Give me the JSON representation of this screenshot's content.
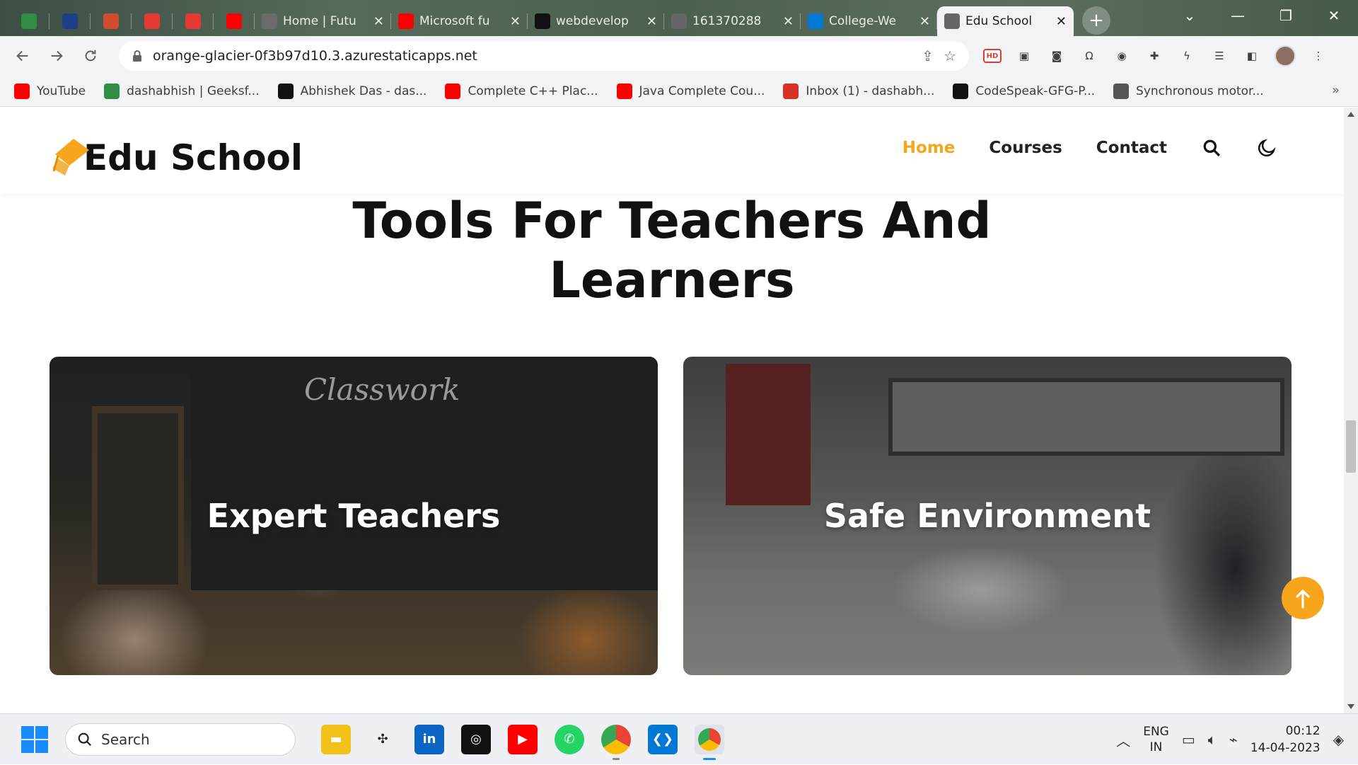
{
  "browser": {
    "tabs": [
      {
        "title": "",
        "icon": "geeksforgeeks-icon",
        "color": "#2f8d46",
        "pinned": true
      },
      {
        "title": "",
        "icon": "elcdn-icon",
        "color": "#1d3f8a",
        "pinned": true
      },
      {
        "title": "",
        "icon": "bharat-intern-icon",
        "color": "#d14b2e",
        "pinned": true
      },
      {
        "title": "",
        "icon": "apple-red-icon",
        "color": "#e53935",
        "pinned": true
      },
      {
        "title": "",
        "icon": "apple-red-icon",
        "color": "#e53935",
        "pinned": true
      },
      {
        "title": "",
        "icon": "youtube-icon",
        "color": "#ff0000",
        "pinned": true
      },
      {
        "title": "Home | Futu",
        "icon": "site-icon",
        "color": "#6b6b6b",
        "pinned": false
      },
      {
        "title": "Microsoft fu",
        "icon": "youtube-icon",
        "color": "#ff0000",
        "pinned": false
      },
      {
        "title": "webdevelop",
        "icon": "github-icon",
        "color": "#111111",
        "pinned": false
      },
      {
        "title": "161370288",
        "icon": "globe-icon",
        "color": "#666666",
        "pinned": false
      },
      {
        "title": "College-We",
        "icon": "azure-icon",
        "color": "#0078d4",
        "pinned": false
      },
      {
        "title": "Edu School",
        "icon": "globe-icon",
        "color": "#666666",
        "pinned": false,
        "active": true
      }
    ],
    "new_tab": "+",
    "url": "orange-glacier-0f3b97d10.3.azurestaticapps.net",
    "bookmarks": [
      {
        "label": "YouTube",
        "icon": "youtube-icon",
        "color": "#ff0000"
      },
      {
        "label": "dashabhish | Geeksf...",
        "icon": "geeksforgeeks-icon",
        "color": "#2f8d46"
      },
      {
        "label": "Abhishek Das - das...",
        "icon": "hashnode-icon",
        "color": "#111111"
      },
      {
        "label": "Complete C++ Plac...",
        "icon": "youtube-icon",
        "color": "#ff0000"
      },
      {
        "label": "Java Complete Cou...",
        "icon": "youtube-icon",
        "color": "#ff0000"
      },
      {
        "label": "Inbox (1) - dashabh...",
        "icon": "gmail-icon",
        "color": "#d93025"
      },
      {
        "label": "CodeSpeak-GFG-P...",
        "icon": "github-icon",
        "color": "#111111"
      },
      {
        "label": "Synchronous motor...",
        "icon": "globe-icon",
        "color": "#555555"
      }
    ],
    "bookmarks_more": "»"
  },
  "site": {
    "logo_text": "Edu School",
    "nav": [
      {
        "label": "Home",
        "active": true
      },
      {
        "label": "Courses",
        "active": false
      },
      {
        "label": "Contact",
        "active": false
      }
    ],
    "accent_color": "#f7a51c",
    "section_title_line1": "Tools For Teachers And",
    "section_title_line2": "Learners",
    "cards": [
      {
        "label": "Expert Teachers",
        "chalk": "Classwork"
      },
      {
        "label": "Safe Environment"
      }
    ]
  },
  "taskbar": {
    "search_placeholder": "Search",
    "apps": [
      "file-explorer-icon",
      "chatgpt-icon",
      "linkedin-icon",
      "github-icon",
      "youtube-icon",
      "whatsapp-icon",
      "chrome-icon",
      "vscode-icon",
      "chrome-profile-icon"
    ],
    "lang_line1": "ENG",
    "lang_line2": "IN",
    "time": "00:12",
    "date": "14-04-2023"
  }
}
